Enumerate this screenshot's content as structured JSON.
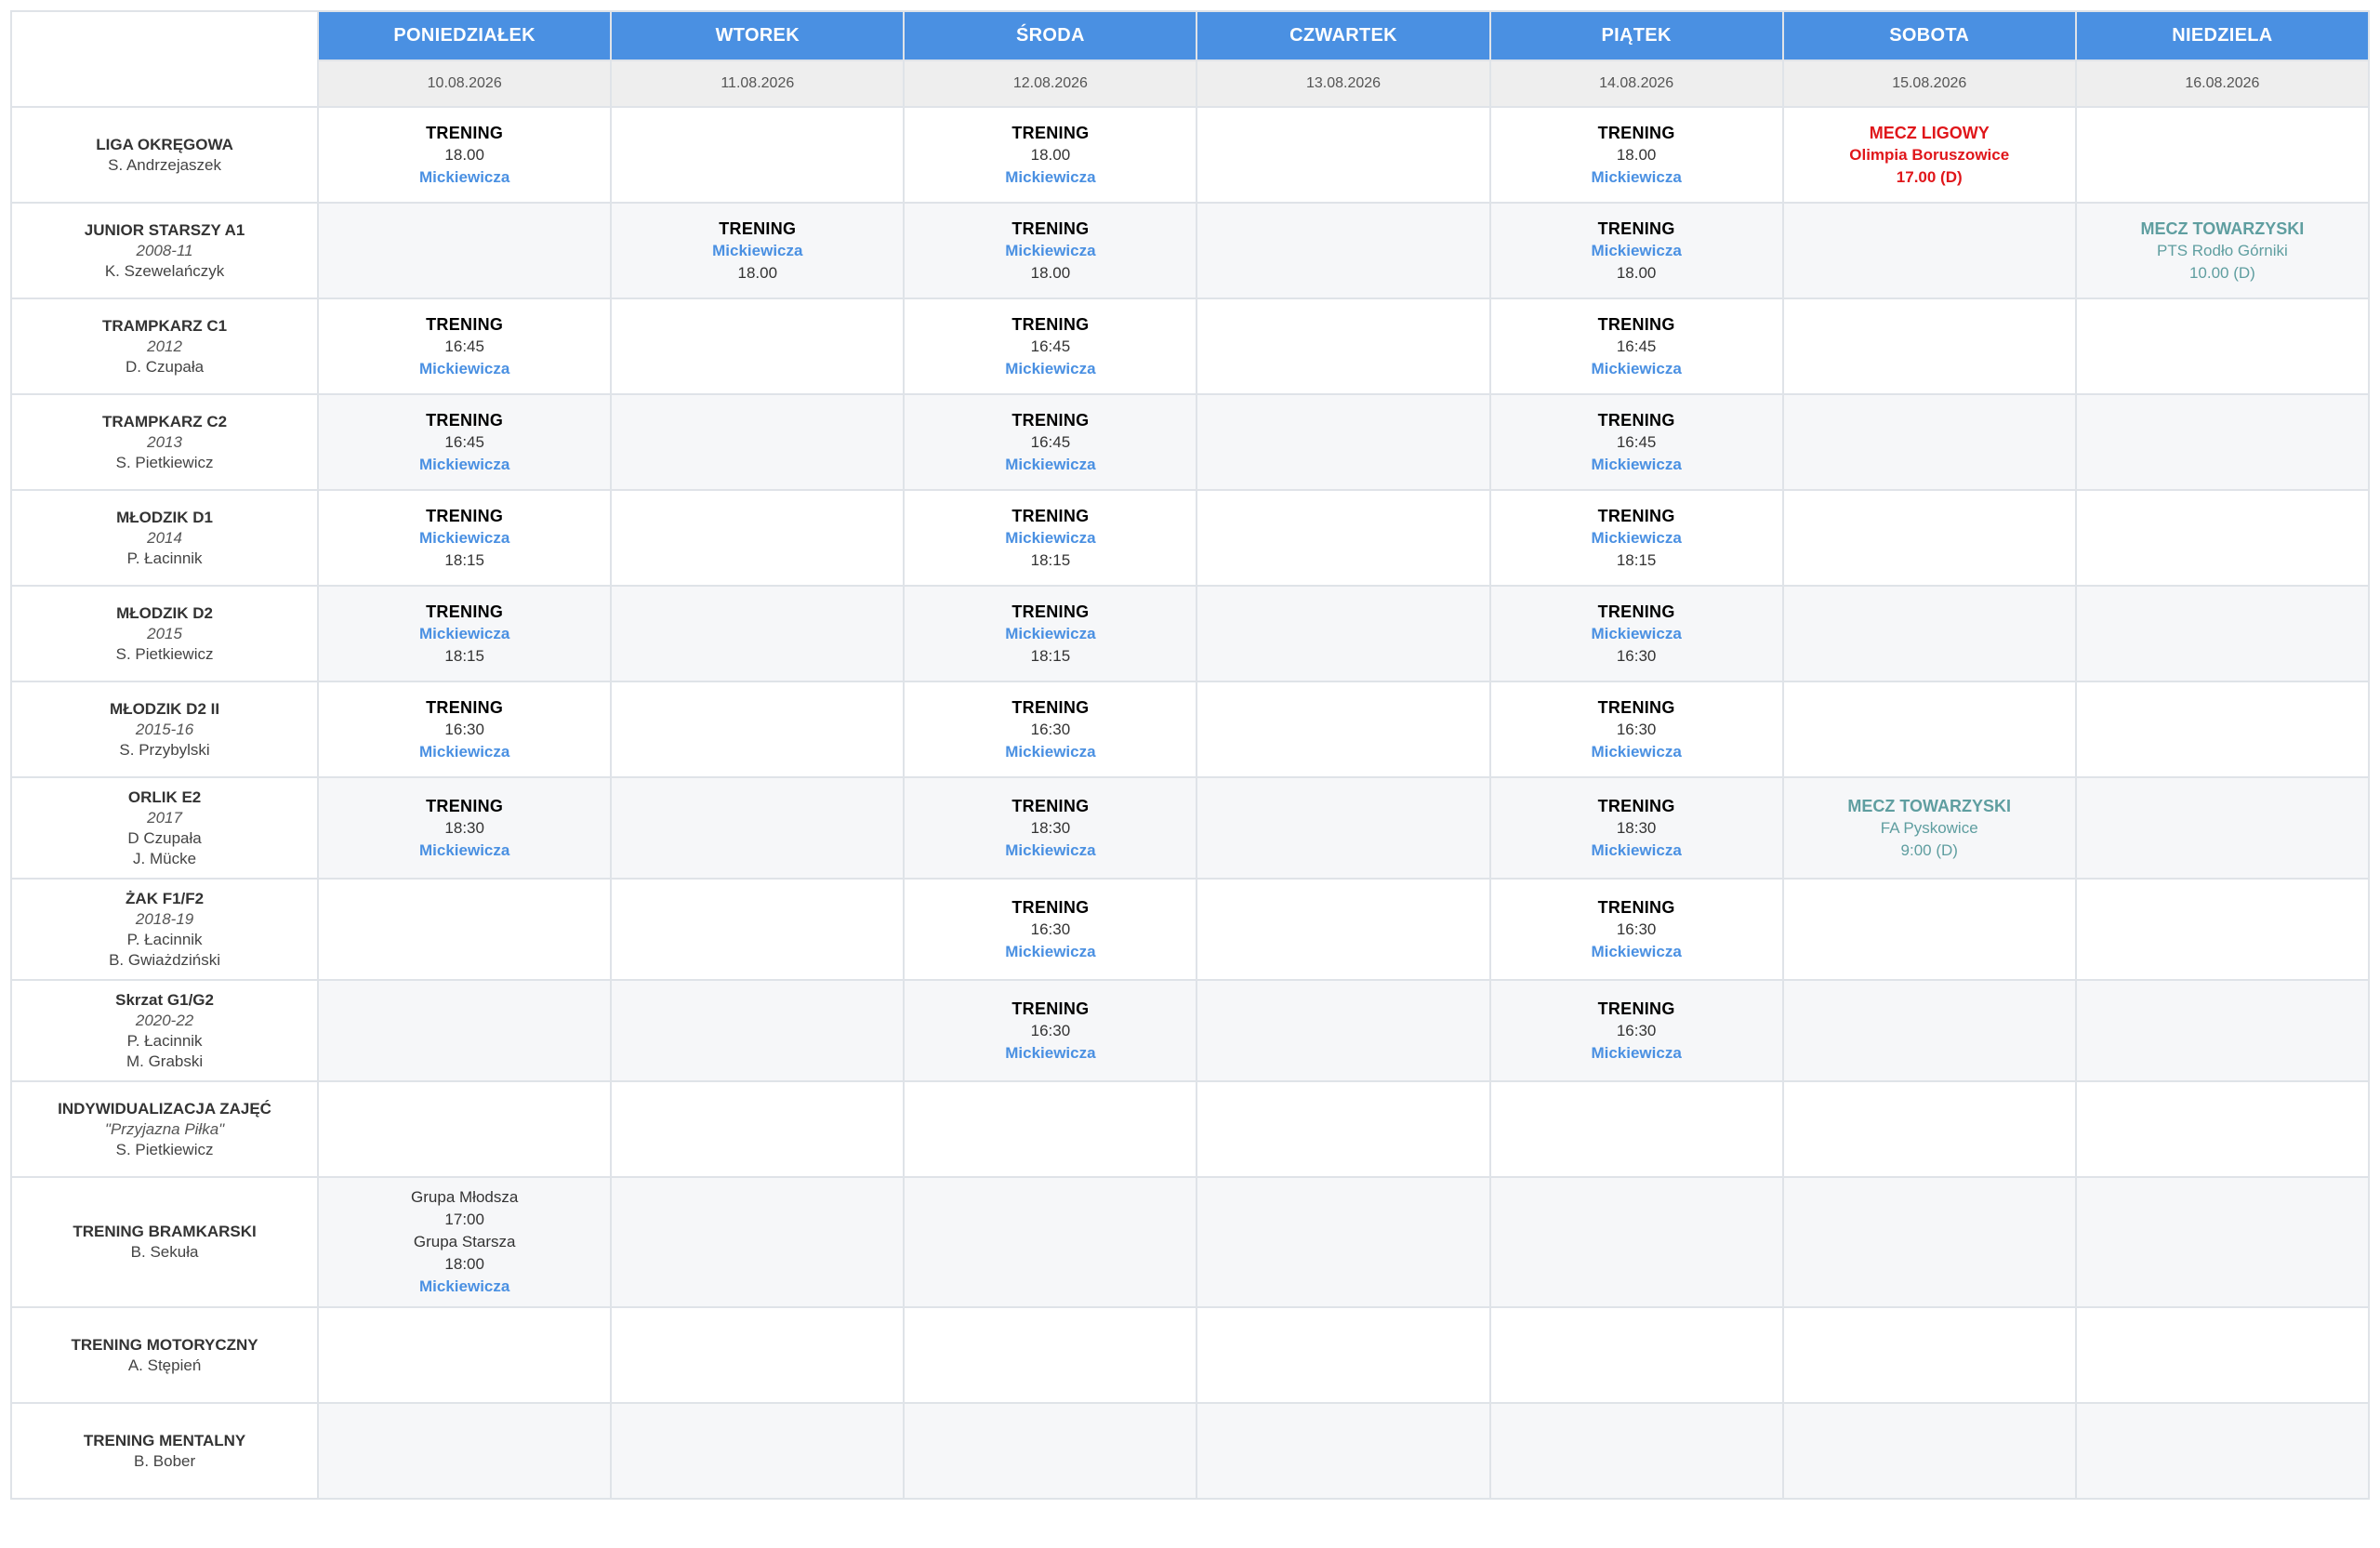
{
  "days": [
    {
      "name": "PONIEDZIAŁEK",
      "date": "10.08.2026"
    },
    {
      "name": "WTOREK",
      "date": "11.08.2026"
    },
    {
      "name": "ŚRODA",
      "date": "12.08.2026"
    },
    {
      "name": "CZWARTEK",
      "date": "13.08.2026"
    },
    {
      "name": "PIĄTEK",
      "date": "14.08.2026"
    },
    {
      "name": "SOBOTA",
      "date": "15.08.2026"
    },
    {
      "name": "NIEDZIELA",
      "date": "16.08.2026"
    }
  ],
  "rows": [
    {
      "title": "LIGA OKRĘGOWA",
      "year": "",
      "coaches": [
        "S. Andrzejaszek"
      ],
      "height": 103,
      "cells": [
        [
          {
            "t": "TRENING",
            "c": "ev-title"
          },
          {
            "t": "18.00",
            "c": "ev-time"
          },
          {
            "t": "Mickiewicza",
            "c": "ev-loc"
          }
        ],
        [],
        [
          {
            "t": "TRENING",
            "c": "ev-title"
          },
          {
            "t": "18.00",
            "c": "ev-time"
          },
          {
            "t": "Mickiewicza",
            "c": "ev-loc"
          }
        ],
        [],
        [
          {
            "t": "TRENING",
            "c": "ev-title"
          },
          {
            "t": "18.00",
            "c": "ev-time"
          },
          {
            "t": "Mickiewicza",
            "c": "ev-loc"
          }
        ],
        [
          {
            "t": "MECZ LIGOWY",
            "c": "ev-liga-title"
          },
          {
            "t": "Olimpia Boruszowice",
            "c": "ev-liga"
          },
          {
            "t": "17.00 (D)",
            "c": "ev-liga"
          }
        ],
        []
      ]
    },
    {
      "title": "JUNIOR STARSZY A1",
      "year": "2008-11",
      "coaches": [
        "K. Szewelańczyk"
      ],
      "height": 103,
      "cells": [
        [],
        [
          {
            "t": "TRENING",
            "c": "ev-title"
          },
          {
            "t": "Mickiewicza",
            "c": "ev-loc"
          },
          {
            "t": "18.00",
            "c": "ev-time"
          }
        ],
        [
          {
            "t": "TRENING",
            "c": "ev-title"
          },
          {
            "t": "Mickiewicza",
            "c": "ev-loc"
          },
          {
            "t": "18.00",
            "c": "ev-time"
          }
        ],
        [],
        [
          {
            "t": "TRENING",
            "c": "ev-title"
          },
          {
            "t": "Mickiewicza",
            "c": "ev-loc"
          },
          {
            "t": "18.00",
            "c": "ev-time"
          }
        ],
        [],
        [
          {
            "t": "MECZ TOWARZYSKI",
            "c": "ev-friend-title"
          },
          {
            "t": "PTS Rodło Górniki",
            "c": "ev-friend"
          },
          {
            "t": "10.00 (D)",
            "c": "ev-friend"
          }
        ]
      ]
    },
    {
      "title": "TRAMPKARZ C1",
      "year": "2012",
      "coaches": [
        "D. Czupała"
      ],
      "height": 103,
      "cells": [
        [
          {
            "t": "TRENING",
            "c": "ev-title"
          },
          {
            "t": "16:45",
            "c": "ev-time"
          },
          {
            "t": "Mickiewicza",
            "c": "ev-loc"
          }
        ],
        [],
        [
          {
            "t": "TRENING",
            "c": "ev-title"
          },
          {
            "t": "16:45",
            "c": "ev-time"
          },
          {
            "t": "Mickiewicza",
            "c": "ev-loc"
          }
        ],
        [],
        [
          {
            "t": "TRENING",
            "c": "ev-title"
          },
          {
            "t": "16:45",
            "c": "ev-time"
          },
          {
            "t": "Mickiewicza",
            "c": "ev-loc"
          }
        ],
        [],
        []
      ]
    },
    {
      "title": "TRAMPKARZ C2",
      "year": "2013",
      "coaches": [
        "S. Pietkiewicz"
      ],
      "height": 103,
      "cells": [
        [
          {
            "t": "TRENING",
            "c": "ev-title"
          },
          {
            "t": "16:45",
            "c": "ev-time"
          },
          {
            "t": "Mickiewicza",
            "c": "ev-loc"
          }
        ],
        [],
        [
          {
            "t": "TRENING",
            "c": "ev-title"
          },
          {
            "t": "16:45",
            "c": "ev-time"
          },
          {
            "t": "Mickiewicza",
            "c": "ev-loc"
          }
        ],
        [],
        [
          {
            "t": "TRENING",
            "c": "ev-title"
          },
          {
            "t": "16:45",
            "c": "ev-time"
          },
          {
            "t": "Mickiewicza",
            "c": "ev-loc"
          }
        ],
        [],
        []
      ]
    },
    {
      "title": "MŁODZIK D1",
      "year": "2014",
      "coaches": [
        "P. Łacinnik"
      ],
      "height": 103,
      "cells": [
        [
          {
            "t": "TRENING",
            "c": "ev-title"
          },
          {
            "t": "Mickiewicza",
            "c": "ev-loc"
          },
          {
            "t": "18:15",
            "c": "ev-time"
          }
        ],
        [],
        [
          {
            "t": "TRENING",
            "c": "ev-title"
          },
          {
            "t": "Mickiewicza",
            "c": "ev-loc"
          },
          {
            "t": "18:15",
            "c": "ev-time"
          }
        ],
        [],
        [
          {
            "t": "TRENING",
            "c": "ev-title"
          },
          {
            "t": "Mickiewicza",
            "c": "ev-loc"
          },
          {
            "t": "18:15",
            "c": "ev-time"
          }
        ],
        [],
        []
      ]
    },
    {
      "title": "MŁODZIK D2",
      "year": "2015",
      "coaches": [
        "S. Pietkiewicz"
      ],
      "height": 103,
      "cells": [
        [
          {
            "t": "TRENING",
            "c": "ev-title"
          },
          {
            "t": "Mickiewicza",
            "c": "ev-loc"
          },
          {
            "t": "18:15",
            "c": "ev-time"
          }
        ],
        [],
        [
          {
            "t": "TRENING",
            "c": "ev-title"
          },
          {
            "t": "Mickiewicza",
            "c": "ev-loc"
          },
          {
            "t": "18:15",
            "c": "ev-time"
          }
        ],
        [],
        [
          {
            "t": "TRENING",
            "c": "ev-title"
          },
          {
            "t": "Mickiewicza",
            "c": "ev-loc"
          },
          {
            "t": "16:30",
            "c": "ev-time"
          }
        ],
        [],
        []
      ]
    },
    {
      "title": "MŁODZIK D2 II",
      "year": "2015-16",
      "coaches": [
        "S. Przybylski"
      ],
      "height": 103,
      "cells": [
        [
          {
            "t": "TRENING",
            "c": "ev-title"
          },
          {
            "t": "16:30",
            "c": "ev-time"
          },
          {
            "t": "Mickiewicza",
            "c": "ev-loc"
          }
        ],
        [],
        [
          {
            "t": "TRENING",
            "c": "ev-title"
          },
          {
            "t": "16:30",
            "c": "ev-time"
          },
          {
            "t": "Mickiewicza",
            "c": "ev-loc"
          }
        ],
        [],
        [
          {
            "t": "TRENING",
            "c": "ev-title"
          },
          {
            "t": "16:30",
            "c": "ev-time"
          },
          {
            "t": "Mickiewicza",
            "c": "ev-loc"
          }
        ],
        [],
        []
      ]
    },
    {
      "title": "ORLIK E2",
      "year": "2017",
      "coaches": [
        "D Czupała",
        "J. Mücke"
      ],
      "height": 109,
      "cells": [
        [
          {
            "t": "TRENING",
            "c": "ev-title"
          },
          {
            "t": "18:30",
            "c": "ev-time"
          },
          {
            "t": "Mickiewicza",
            "c": "ev-loc"
          }
        ],
        [],
        [
          {
            "t": "TRENING",
            "c": "ev-title"
          },
          {
            "t": "18:30",
            "c": "ev-time"
          },
          {
            "t": "Mickiewicza",
            "c": "ev-loc"
          }
        ],
        [],
        [
          {
            "t": "TRENING",
            "c": "ev-title"
          },
          {
            "t": "18:30",
            "c": "ev-time"
          },
          {
            "t": "Mickiewicza",
            "c": "ev-loc"
          }
        ],
        [
          {
            "t": "MECZ TOWARZYSKI",
            "c": "ev-friend-title"
          },
          {
            "t": "FA Pyskowice",
            "c": "ev-friend"
          },
          {
            "t": "9:00 (D)",
            "c": "ev-friend"
          }
        ],
        []
      ]
    },
    {
      "title": "ŻAK F1/F2",
      "year": "2018-19",
      "coaches": [
        "P. Łacinnik",
        "B. Gwiażdziński"
      ],
      "height": 109,
      "cells": [
        [],
        [],
        [
          {
            "t": "TRENING",
            "c": "ev-title"
          },
          {
            "t": "16:30",
            "c": "ev-time"
          },
          {
            "t": "Mickiewicza",
            "c": "ev-loc"
          }
        ],
        [],
        [
          {
            "t": "TRENING",
            "c": "ev-title"
          },
          {
            "t": "16:30",
            "c": "ev-time"
          },
          {
            "t": "Mickiewicza",
            "c": "ev-loc"
          }
        ],
        [],
        []
      ]
    },
    {
      "title": "Skrzat G1/G2",
      "year": "2020-22",
      "coaches": [
        "P. Łacinnik",
        "M. Grabski"
      ],
      "height": 109,
      "cells": [
        [],
        [],
        [
          {
            "t": "TRENING",
            "c": "ev-title"
          },
          {
            "t": "16:30",
            "c": "ev-time"
          },
          {
            "t": "Mickiewicza",
            "c": "ev-loc"
          }
        ],
        [],
        [
          {
            "t": "TRENING",
            "c": "ev-title"
          },
          {
            "t": "16:30",
            "c": "ev-time"
          },
          {
            "t": "Mickiewicza",
            "c": "ev-loc"
          }
        ],
        [],
        []
      ]
    },
    {
      "title": "INDYWIDUALIZACJA ZAJĘĆ",
      "year": "\"Przyjazna Piłka\"",
      "coaches": [
        "S. Pietkiewicz"
      ],
      "height": 103,
      "cells": [
        [],
        [],
        [],
        [],
        [],
        [],
        []
      ]
    },
    {
      "title": "TRENING BRAMKARSKI",
      "year": "",
      "coaches": [
        "B. Sekuła"
      ],
      "height": 140,
      "cells": [
        [
          {
            "t": "Grupa Młodsza",
            "c": "ev-plain"
          },
          {
            "t": "17:00",
            "c": "ev-plain"
          },
          {
            "t": "Grupa Starsza",
            "c": "ev-plain"
          },
          {
            "t": "18:00",
            "c": "ev-plain"
          },
          {
            "t": "Mickiewicza",
            "c": "ev-loc"
          }
        ],
        [],
        [],
        [],
        [],
        [],
        []
      ]
    },
    {
      "title": "TRENING MOTORYCZNY",
      "year": "",
      "coaches": [
        "A. Stępień"
      ],
      "height": 103,
      "cells": [
        [],
        [],
        [],
        [],
        [],
        [],
        []
      ]
    },
    {
      "title": "TRENING MENTALNY",
      "year": "",
      "coaches": [
        "B. Bober"
      ],
      "height": 103,
      "cells": [
        [],
        [],
        [],
        [],
        [],
        [],
        []
      ]
    }
  ]
}
